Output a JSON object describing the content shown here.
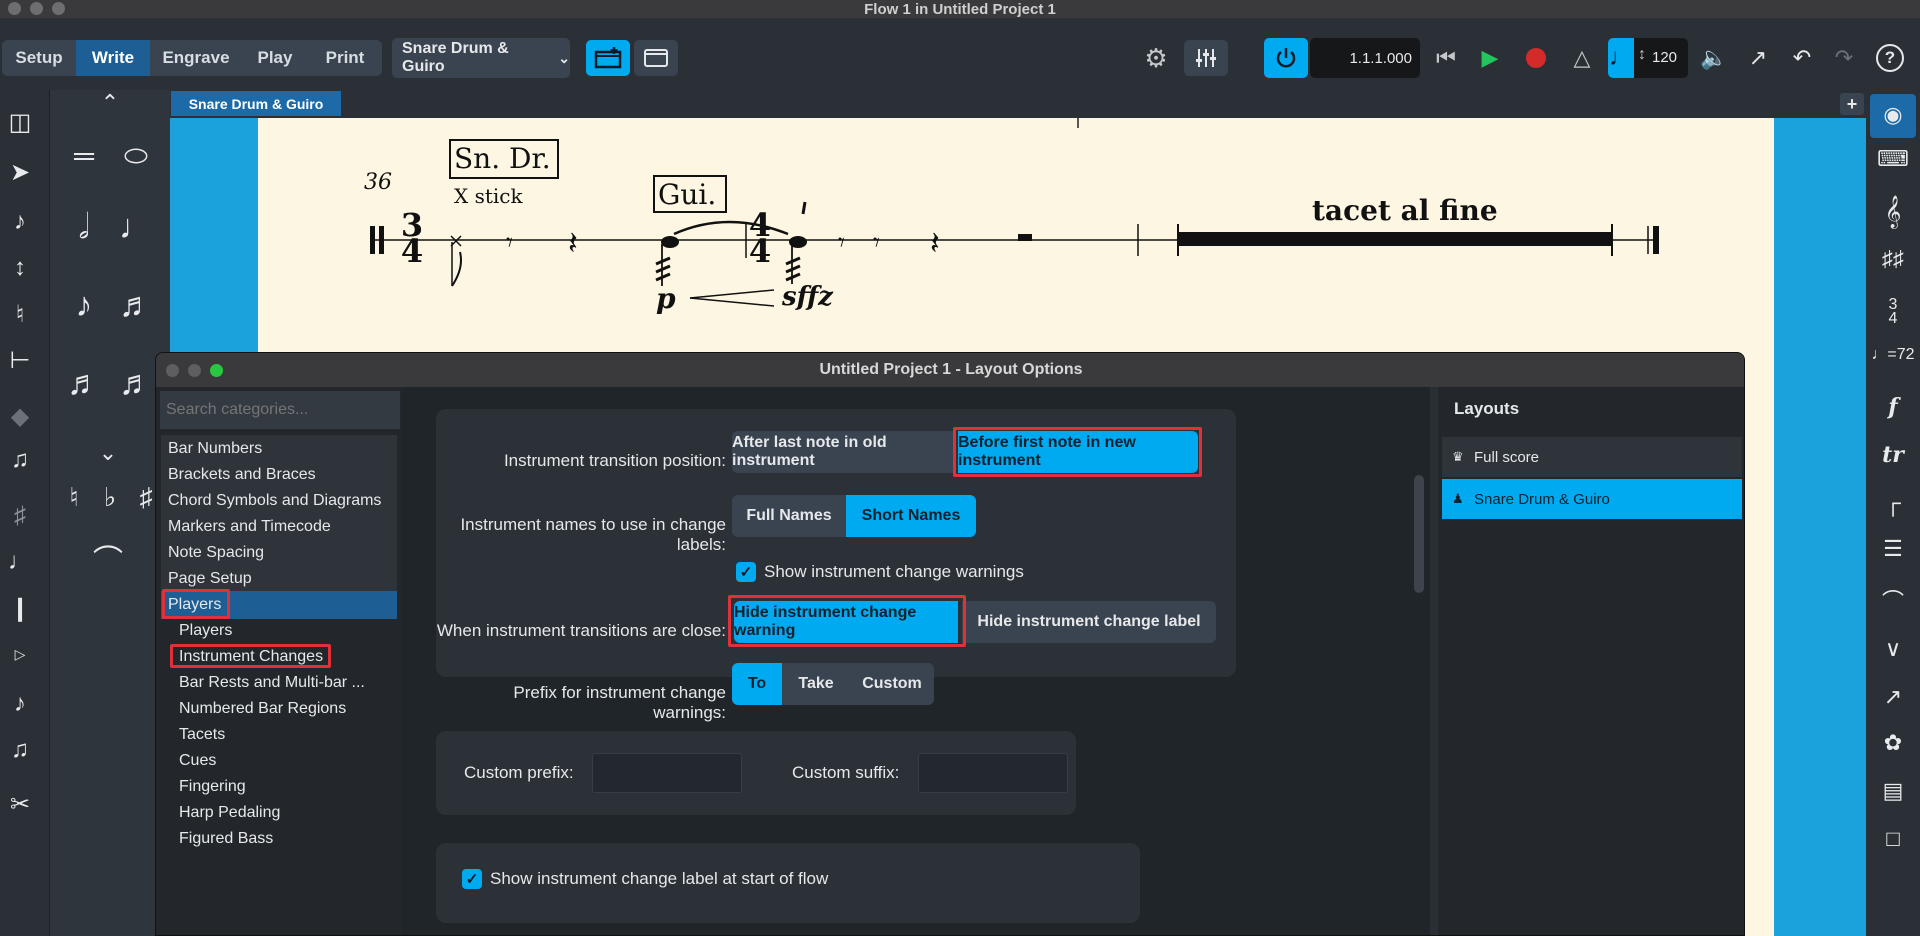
{
  "window_title": "Flow 1 in Untitled Project 1",
  "modes": [
    "Setup",
    "Write",
    "Engrave",
    "Play",
    "Print"
  ],
  "active_mode": "Write",
  "layout_selector": "Snare Drum & Guiro",
  "transport": {
    "position": "1.1.1.000",
    "tempo": "120"
  },
  "score_tab": "Snare Drum & Guiro",
  "score": {
    "bar_number": "36",
    "label_snare": "Sn. Dr.",
    "technique": "X stick",
    "label_guiro": "Gui.",
    "dynamic_start": "p",
    "dynamic_end": "sffz",
    "tacet": "tacet al fine",
    "time_sig_1": [
      "3",
      "4"
    ],
    "time_sig_2": [
      "4",
      "4"
    ]
  },
  "dialog": {
    "title": "Untitled Project 1 - Layout Options",
    "search_placeholder": "Search categories...",
    "categories": [
      {
        "label": "Bar Numbers",
        "kind": "top"
      },
      {
        "label": "Brackets and Braces",
        "kind": "top"
      },
      {
        "label": "Chord Symbols and Diagrams",
        "kind": "top"
      },
      {
        "label": "Markers and Timecode",
        "kind": "top"
      },
      {
        "label": "Note Spacing",
        "kind": "top"
      },
      {
        "label": "Page Setup",
        "kind": "top"
      },
      {
        "label": "Players",
        "kind": "selected"
      },
      {
        "label": "Players",
        "kind": "sub"
      },
      {
        "label": "Instrument Changes",
        "kind": "sub"
      },
      {
        "label": "Bar Rests and Multi-bar ...",
        "kind": "sub"
      },
      {
        "label": "Numbered Bar Regions",
        "kind": "sub"
      },
      {
        "label": "Tacets",
        "kind": "sub"
      },
      {
        "label": "Cues",
        "kind": "sub"
      },
      {
        "label": "Fingering",
        "kind": "sub"
      },
      {
        "label": "Harp Pedaling",
        "kind": "sub"
      },
      {
        "label": "Figured Bass",
        "kind": "sub"
      }
    ],
    "transition_position": {
      "label": "Instrument transition position:",
      "options": [
        "After last note in old instrument",
        "Before first note in new instrument"
      ],
      "selected": "Before first note in new instrument"
    },
    "names_in_labels": {
      "label": "Instrument names to use in change labels:",
      "options": [
        "Full Names",
        "Short Names"
      ],
      "selected": "Short Names"
    },
    "show_warnings": {
      "label": "Show instrument change warnings",
      "checked": true
    },
    "transitions_close": {
      "label": "When instrument transitions are close:",
      "options": [
        "Hide instrument change warning",
        "Hide instrument change label"
      ],
      "selected": "Hide instrument change warning"
    },
    "prefix": {
      "label": "Prefix for instrument change warnings:",
      "options": [
        "To",
        "Take",
        "Custom"
      ],
      "selected": "To"
    },
    "custom_prefix_label": "Custom prefix:",
    "custom_suffix_label": "Custom suffix:",
    "show_label_start": {
      "label": "Show instrument change label at start of flow",
      "checked": true
    },
    "layouts_heading": "Layouts",
    "layouts": [
      {
        "label": "Full score",
        "selected": false
      },
      {
        "label": "Snare Drum & Guiro",
        "selected": true
      }
    ]
  },
  "colors": {
    "accent": "#00aaf0",
    "highlight_box": "#e0303a",
    "paper": "#fdf6e3",
    "score_bg": "#1ba1dc"
  }
}
